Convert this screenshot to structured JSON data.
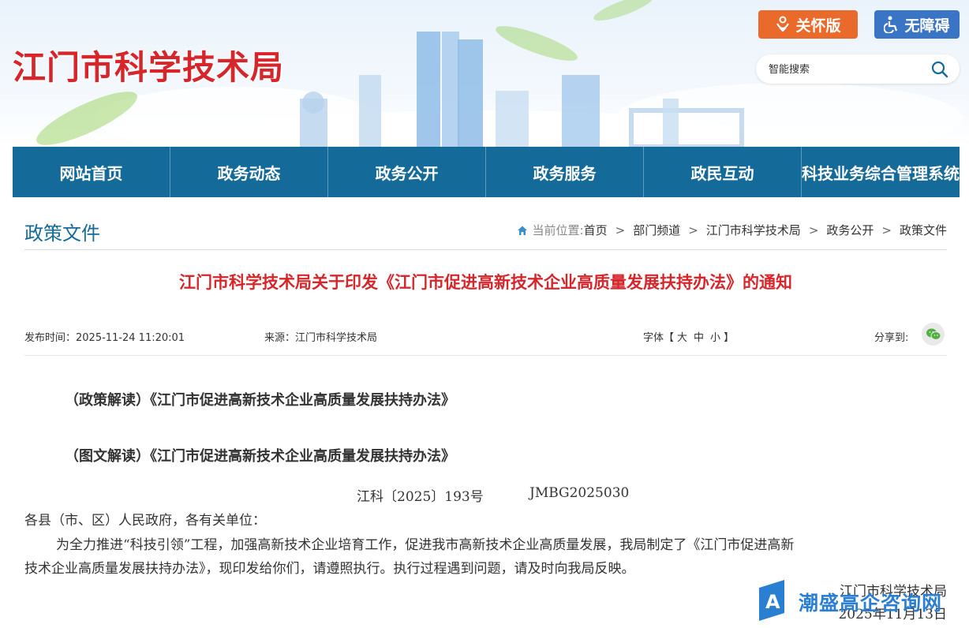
{
  "header": {
    "site_title": "江门市科学技术局",
    "care_label": "关怀版",
    "accessibility_label": "无障碍",
    "search_placeholder": "智能搜索",
    "colors": {
      "title_red": "#d7262b",
      "care_orange": "#ea6a2c",
      "access_blue": "#3975c4"
    }
  },
  "nav": {
    "items": [
      "网站首页",
      "政务动态",
      "政务公开",
      "政务服务",
      "政民互动",
      "科技业务综合管理系统"
    ],
    "color": "#146a99"
  },
  "section": {
    "title": "政策文件",
    "breadcrumb_label": "当前位置:",
    "breadcrumb": [
      "首页",
      "部门频道",
      "江门市科学技术局",
      "政务公开",
      "政策文件"
    ],
    "separator": ">"
  },
  "article": {
    "title": "江门市科学技术局关于印发《江门市促进高新技术企业高质量发展扶持办法》的通知",
    "publish_time": "发布时间：2025-11-24 11:20:01",
    "source": "来源：江门市科学技术局",
    "font_label": "字体【",
    "font_sizes": [
      "大",
      "中",
      "小"
    ],
    "font_close": "】",
    "share_label": "分享到:",
    "interpretation_policy": "（政策解读）《江门市促进高新技术企业高质量发展扶持办法》",
    "interpretation_graphic": "（图文解读）《江门市促进高新技术企业高质量发展扶持办法》",
    "doc_number": "江科〔2025〕193号",
    "doc_code": "JMBG2025030",
    "salutation": "各县（市、区）人民政府，各有关单位：",
    "body_line1": "为全力推进“科技引领”工程，加强高新技术企业培育工作，促进我市高新技术企业高质量发展，我局制定了《江门市促进高新",
    "body_line2": "技术企业高质量发展扶持办法》，现印发给你们，请遵照执行。执行过程遇到问题，请及时向我局反映。",
    "signature_org": "江门市科学技术局",
    "signature_date": "2025年11月13日"
  },
  "watermark": {
    "text": "潮盛高企咨询网",
    "color": "#2b7fd3"
  }
}
